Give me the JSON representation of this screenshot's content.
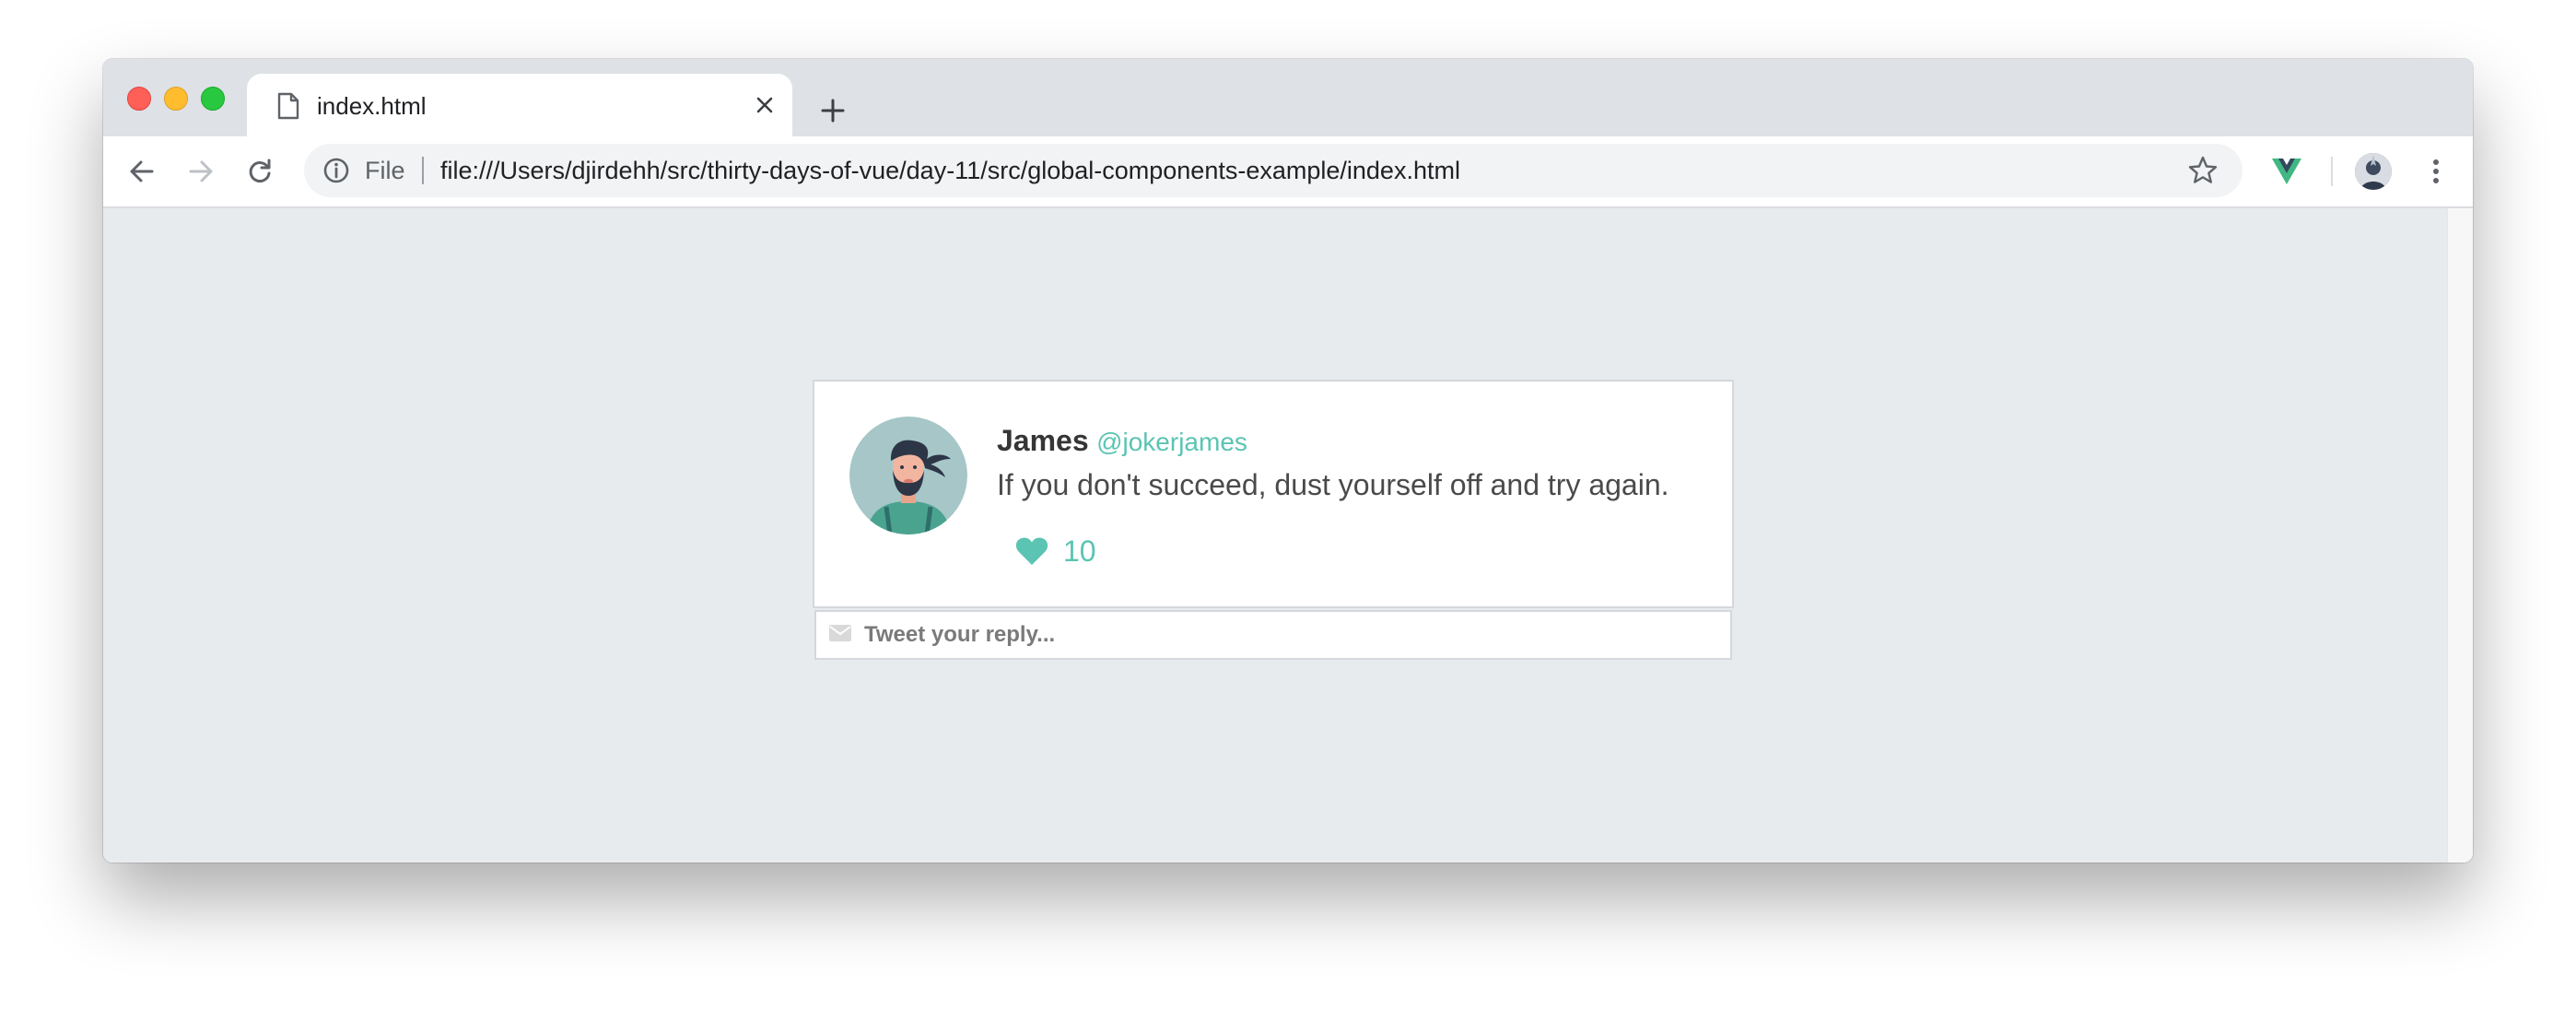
{
  "browser": {
    "tab_title": "index.html",
    "omnibox": {
      "scheme_label": "File",
      "url": "file:///Users/djirdehh/src/thirty-days-of-vue/day-11/src/global-components-example/index.html"
    }
  },
  "tweet": {
    "name": "James",
    "handle": "@jokerjames",
    "text": "If you don't succeed, dust yourself off and try again.",
    "likes": "10",
    "avatar_icon": "bearded-man-avatar"
  },
  "reply": {
    "placeholder": "Tweet your reply..."
  },
  "colors": {
    "accent": "#5bc4b2",
    "page_background": "#e8ebee",
    "tab_strip": "#dee1e6"
  }
}
